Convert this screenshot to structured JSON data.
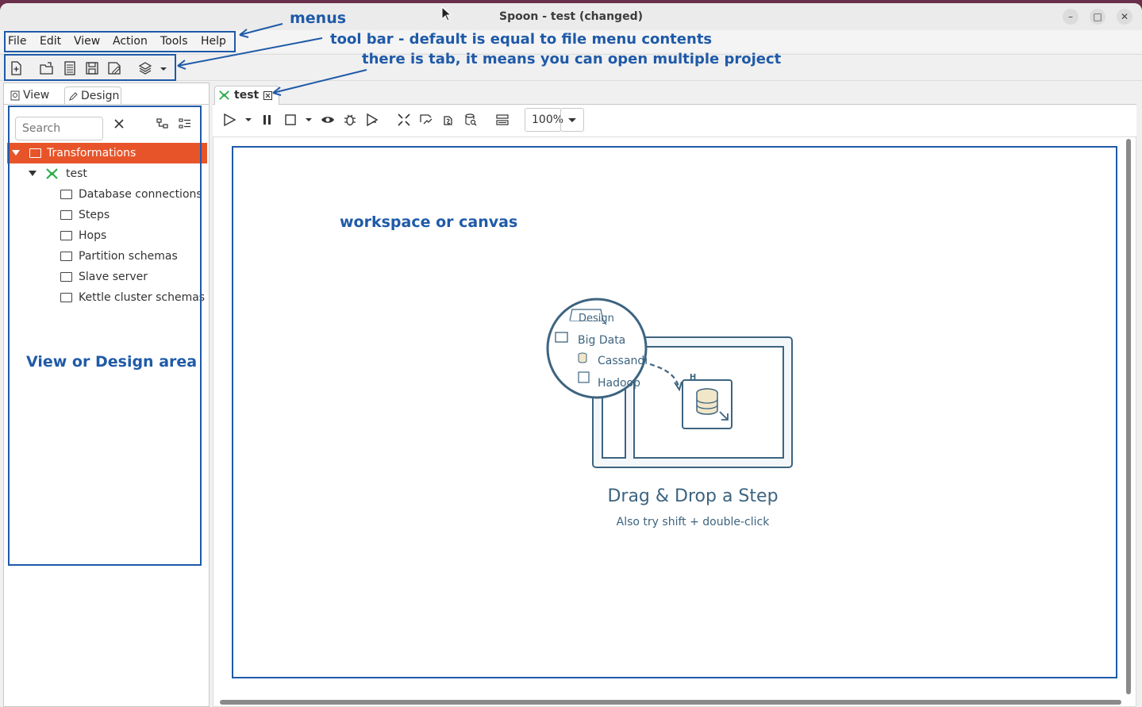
{
  "window": {
    "title": "Spoon - test (changed)"
  },
  "window_controls": {
    "minimize": "–",
    "maximize": "□",
    "close": "✕"
  },
  "menus": [
    "File",
    "Edit",
    "View",
    "Action",
    "Tools",
    "Help"
  ],
  "annotations": {
    "menus": "menus",
    "toolbar": "tool bar - default is equal to file menu contents",
    "tab": "there is tab, it means you can open multiple project",
    "workspace": "workspace or canvas",
    "view_design": "View or Design area"
  },
  "left_panel": {
    "tabs": [
      "View",
      "Design"
    ],
    "search_placeholder": "Search",
    "tree": [
      {
        "label": "Transformations",
        "level": 0,
        "selected": true
      },
      {
        "label": "test",
        "level": 1
      },
      {
        "label": "Database connections",
        "level": 2
      },
      {
        "label": "Steps",
        "level": 2
      },
      {
        "label": "Hops",
        "level": 2
      },
      {
        "label": "Partition schemas",
        "level": 2
      },
      {
        "label": "Slave server",
        "level": 2
      },
      {
        "label": "Kettle cluster schemas",
        "level": 2
      }
    ]
  },
  "editor": {
    "tab_label": "test",
    "zoom": "100%"
  },
  "canvas": {
    "illustration": {
      "tab": "Design",
      "folder": "Big Data",
      "items": [
        "Cassandr",
        "Hadoop"
      ]
    },
    "hint_title": "Drag & Drop a Step",
    "hint_subtitle": "Also try shift + double-click"
  },
  "colors": {
    "selection": "#e8542a",
    "annotation": "#1f5aa8",
    "steel": "#3d6480"
  }
}
